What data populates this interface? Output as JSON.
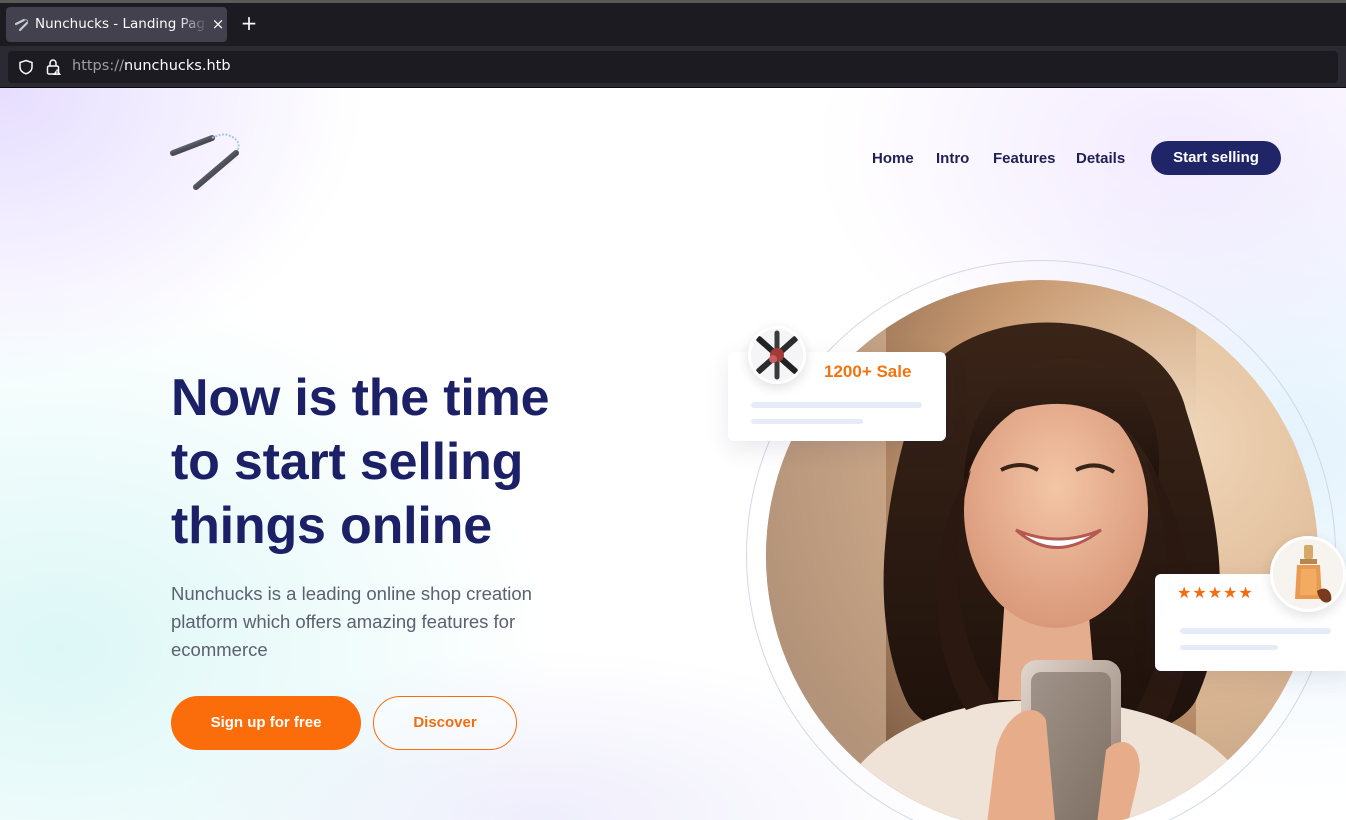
{
  "browser": {
    "tab_title": "Nunchucks - Landing Page",
    "tab_close_glyph": "×",
    "new_tab_glyph": "+",
    "url_scheme": "https://",
    "url_host": "nunchucks.htb"
  },
  "nav": {
    "items": [
      {
        "label": "Home"
      },
      {
        "label": "Intro"
      },
      {
        "label": "Features"
      },
      {
        "label": "Details"
      }
    ],
    "cta_label": "Start selling"
  },
  "hero": {
    "headline_lines": [
      "Now is the time",
      "to start selling",
      "things online"
    ],
    "subtext": "Nunchucks is a leading online shop creation platform which offers amazing features for ecommerce",
    "primary_button": "Sign up for free",
    "secondary_button": "Discover"
  },
  "cards": {
    "sale_label": "1200+ Sale",
    "rating_stars": "★★★★★",
    "rating_value": 5
  },
  "colors": {
    "brand_navy": "#1c2066",
    "accent_orange": "#fb6d0a",
    "browser_bg": "#1c1b22"
  },
  "icons": {
    "tab_favicon": "nunchucks-icon",
    "shield": "shield-icon",
    "lock": "lock-icon",
    "logo": "nunchucks-logo"
  }
}
